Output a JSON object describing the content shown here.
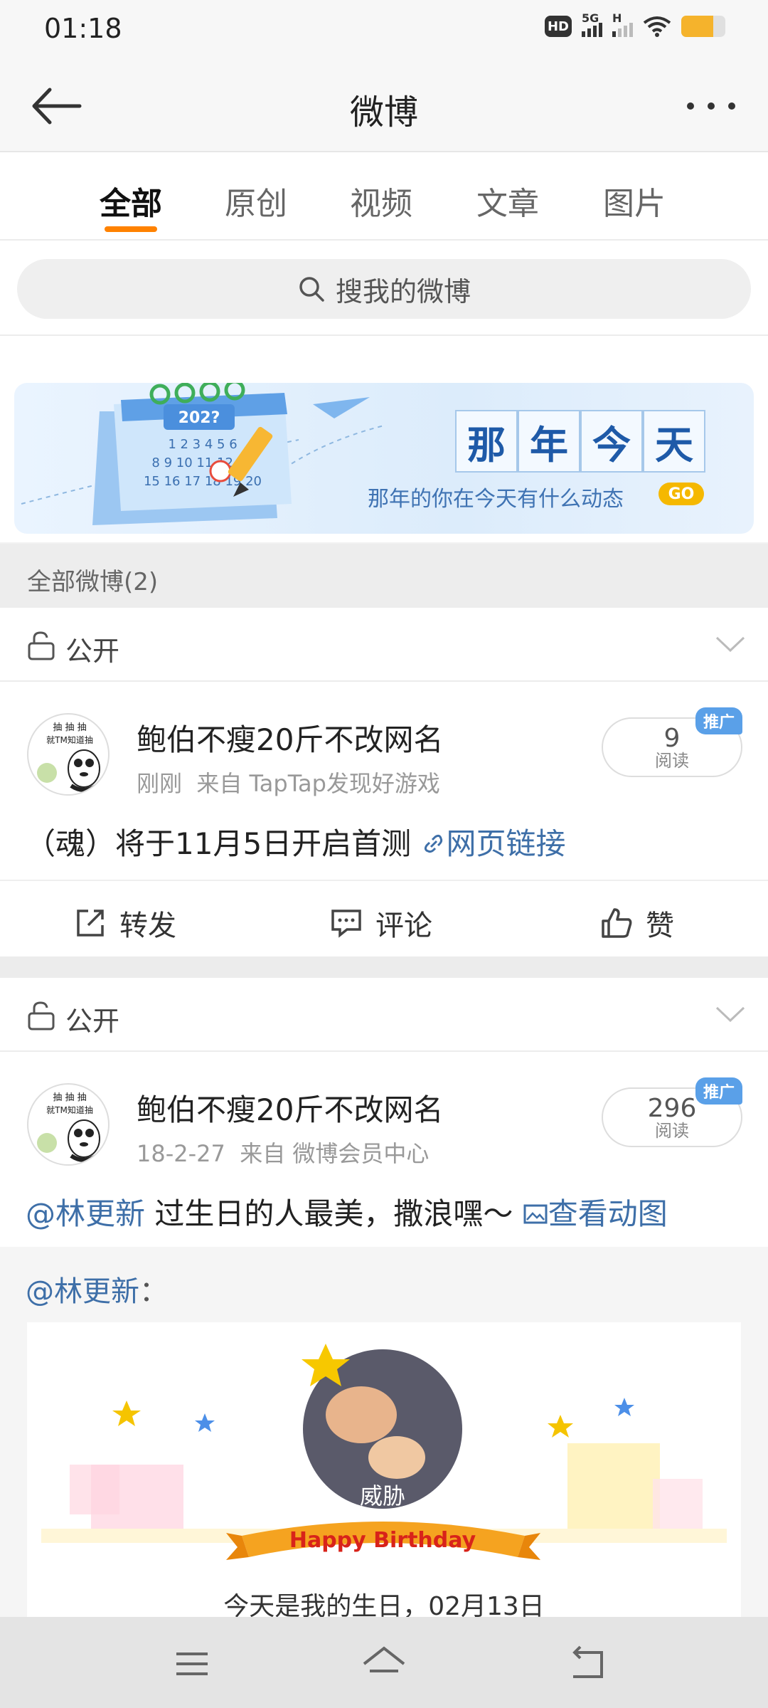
{
  "status_bar": {
    "time": "01:18",
    "network1": "5G",
    "network2": "H",
    "hd": "HD"
  },
  "nav": {
    "title": "微博"
  },
  "tabs": [
    {
      "label": "全部",
      "active": true
    },
    {
      "label": "原创",
      "active": false
    },
    {
      "label": "视频",
      "active": false
    },
    {
      "label": "文章",
      "active": false
    },
    {
      "label": "图片",
      "active": false
    }
  ],
  "search": {
    "placeholder": "搜我的微博"
  },
  "banner": {
    "title_chars": [
      "那",
      "年",
      "今",
      "天"
    ],
    "subtitle": "那年的你在今天有什么动态",
    "go_label": "GO",
    "calendar_year": "202?"
  },
  "section": {
    "title": "全部微博(2)"
  },
  "posts": [
    {
      "privacy": "公开",
      "username": "鲍伯不瘦20斤不改网名",
      "time": "刚刚",
      "source": "来自 TapTap发现好游戏",
      "reads": "9",
      "reads_label": "阅读",
      "promo": "推广",
      "text": "（魂）将于11月5日开启首测",
      "link_text": "网页链接",
      "actions": {
        "repost": "转发",
        "comment": "评论",
        "like": "赞"
      }
    },
    {
      "privacy": "公开",
      "username": "鲍伯不瘦20斤不改网名",
      "time": "18-2-27",
      "source": "来自 微博会员中心",
      "reads": "296",
      "reads_label": "阅读",
      "promo": "推广",
      "mention": "@林更新",
      "text": " 过生日的人最美，撒浪嘿～ ",
      "link_text": "查看动图",
      "repost_user": "@林更新",
      "repost_colon": "：",
      "card_badge_text": "威胁",
      "card_banner": "Happy Birthday",
      "card_text": "今天是我的生日，02月13日"
    }
  ],
  "avatar_text": {
    "line1": "抽 抽 抽",
    "line2": "就TM知道抽"
  },
  "colors": {
    "accent": "#ff8200",
    "link": "#3e6fa8",
    "promo": "#5aa0e8",
    "go": "#f5b800"
  }
}
